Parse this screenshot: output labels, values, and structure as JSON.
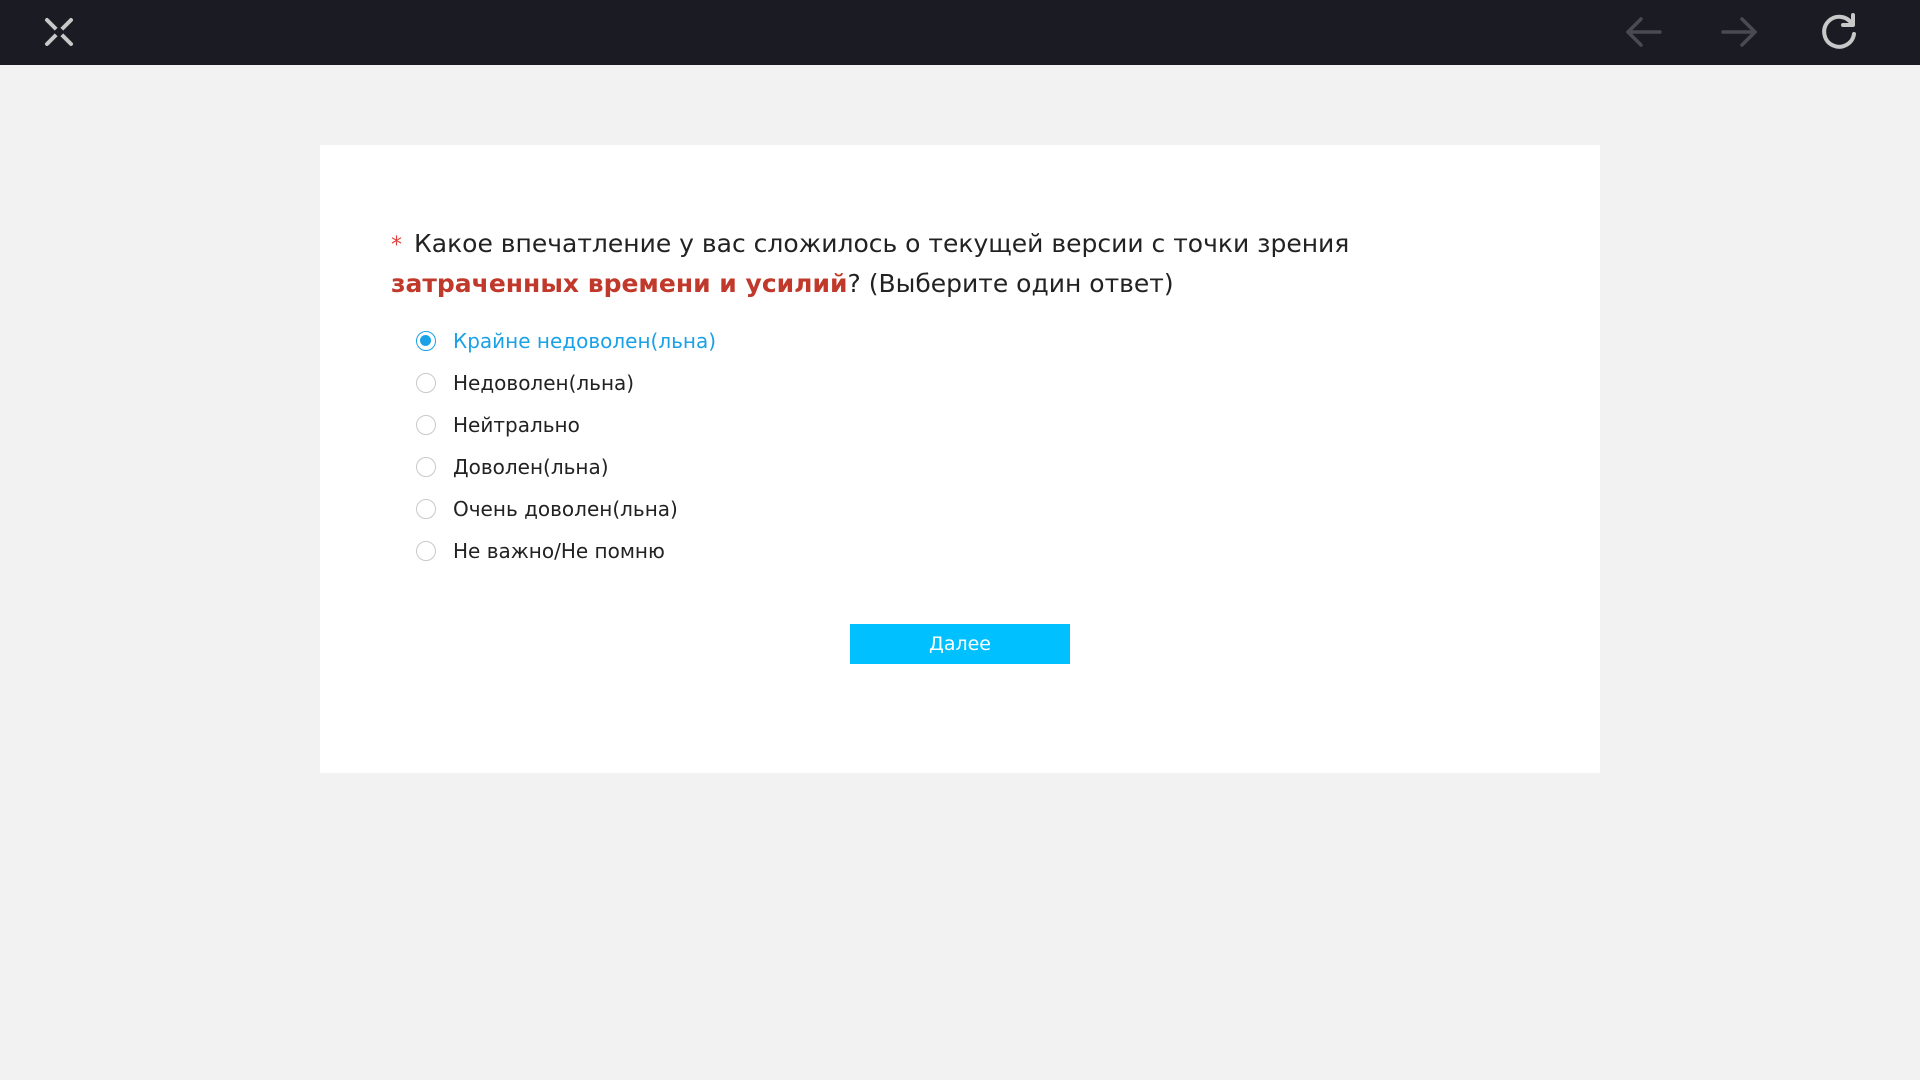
{
  "toolbar": {
    "close_icon": "close-icon",
    "back_icon": "arrow-left-icon",
    "forward_icon": "arrow-right-icon",
    "reload_icon": "reload-icon",
    "background_color": "#1a1b23"
  },
  "survey": {
    "required_mark": "*",
    "question_prefix": "Какое впечатление у вас сложилось о текущей версии с точки зрения ",
    "question_highlight": "затраченных времени и усилий",
    "question_suffix": "?  (Выберите один ответ)",
    "options": [
      {
        "label": "Крайне недоволен(льна)",
        "selected": true
      },
      {
        "label": "Недоволен(льна)",
        "selected": false
      },
      {
        "label": "Нейтрально",
        "selected": false
      },
      {
        "label": "Доволен(льна)",
        "selected": false
      },
      {
        "label": "Очень доволен(льна)",
        "selected": false
      },
      {
        "label": "Не важно/Не помню",
        "selected": false
      }
    ],
    "next_button_label": "Далее"
  },
  "colors": {
    "accent": "#1aa1e6",
    "button": "#00c0ff",
    "highlight": "#c0392b",
    "page_background": "#f2f2f2"
  }
}
